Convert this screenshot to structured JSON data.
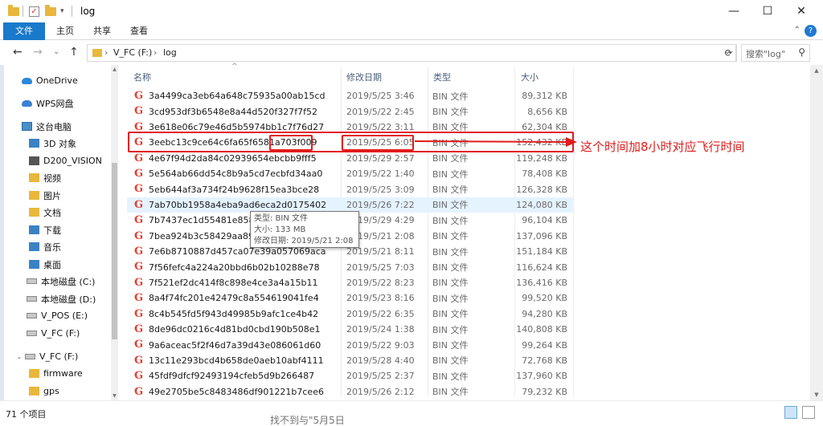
{
  "window": {
    "title": "log",
    "minimize": "—",
    "maximize": "☐",
    "close": "✕"
  },
  "ribbon": {
    "tabs": [
      "文件",
      "主页",
      "共享",
      "查看"
    ],
    "help": "?",
    "collapse": "⌃"
  },
  "address": {
    "back": "←",
    "forward": "→",
    "recent": "⌄",
    "up": "↑",
    "path": [
      "V_FC (F:)",
      "log"
    ],
    "separator": "›",
    "dropdown": "⌄",
    "refresh": "⟳",
    "search_placeholder": "搜索\"log\"",
    "search_icon": "search-icon"
  },
  "nav": {
    "items": [
      {
        "label": "OneDrive",
        "icon": "cloud-icon",
        "indent": 0
      },
      {
        "label": "WPS网盘",
        "icon": "cloud-icon",
        "indent": 0
      },
      {
        "label": "这台电脑",
        "icon": "computer-icon",
        "indent": 0
      },
      {
        "label": "3D 对象",
        "icon": "folder-icon",
        "indent": 1
      },
      {
        "label": "D200_VISION",
        "icon": "device-icon",
        "indent": 1
      },
      {
        "label": "视频",
        "icon": "folder-icon",
        "indent": 1
      },
      {
        "label": "图片",
        "icon": "folder-icon",
        "indent": 1
      },
      {
        "label": "文档",
        "icon": "folder-icon",
        "indent": 1
      },
      {
        "label": "下载",
        "icon": "folder-icon",
        "indent": 1
      },
      {
        "label": "音乐",
        "icon": "folder-icon",
        "indent": 1
      },
      {
        "label": "桌面",
        "icon": "folder-icon",
        "indent": 1
      },
      {
        "label": "本地磁盘 (C:)",
        "icon": "drive-icon",
        "indent": 1
      },
      {
        "label": "本地磁盘 (D:)",
        "icon": "drive-icon",
        "indent": 1
      },
      {
        "label": "V_POS (E:)",
        "icon": "drive-icon",
        "indent": 1
      },
      {
        "label": "V_FC (F:)",
        "icon": "drive-icon",
        "indent": 1
      },
      {
        "label": "V_FC (F:)",
        "icon": "drive-icon",
        "indent": 0
      },
      {
        "label": "firmware",
        "icon": "folder-icon",
        "indent": 1
      },
      {
        "label": "gps",
        "icon": "folder-icon",
        "indent": 1
      }
    ]
  },
  "columns": {
    "name": "名称",
    "date": "修改日期",
    "type": "类型",
    "size": "大小",
    "sort_caret": "^"
  },
  "files": [
    {
      "name": "3a4499ca3eb64a648c75935a00ab15cd",
      "date": "2019/5/25 3:46",
      "type": "BIN 文件",
      "size": "89,312 KB"
    },
    {
      "name": "3cd953df3b6548e8a44d520f327f7f52",
      "date": "2019/5/22 2:45",
      "type": "BIN 文件",
      "size": "8,656 KB"
    },
    {
      "name": "3e618e06c79e46d5b5974bb1c7f76d27",
      "date": "2019/5/22 3:11",
      "type": "BIN 文件",
      "size": "62,304 KB"
    },
    {
      "name": "3eebc13c9ce64c6fa65f6581a703f009",
      "date": "2019/5/25 6:05",
      "type": "BIN 文件",
      "size": "152,432 KB"
    },
    {
      "name": "4e67f94d2da84c02939654ebcbb9fff5",
      "date": "2019/5/29 2:57",
      "type": "BIN 文件",
      "size": "119,248 KB"
    },
    {
      "name": "5e564ab66dd54c8b9a5cd7ecbfd34aa0",
      "date": "2019/5/22 1:40",
      "type": "BIN 文件",
      "size": "78,408 KB"
    },
    {
      "name": "5eb644af3a734f24b9628f15ea3bce28",
      "date": "2019/5/25 3:09",
      "type": "BIN 文件",
      "size": "126,328 KB"
    },
    {
      "name": "7ab70bb1958a4eba9ad6eca2d0175402",
      "date": "2019/5/26 7:22",
      "type": "BIN 文件",
      "size": "124,080 KB"
    },
    {
      "name": "7b7437ec1d55481e858",
      "date": "2019/5/29 4:29",
      "type": "BIN 文件",
      "size": "96,104 KB"
    },
    {
      "name": "7bea924b3c58429aa89",
      "date": "2019/5/21 2:08",
      "type": "BIN 文件",
      "size": "137,096 KB"
    },
    {
      "name": "7e6b8710887d457ca07e39a057069aca",
      "date": "2019/5/21 8:11",
      "type": "BIN 文件",
      "size": "151,184 KB"
    },
    {
      "name": "7f56fefc4a224a20bbd6b02b10288e78",
      "date": "2019/5/25 7:03",
      "type": "BIN 文件",
      "size": "116,624 KB"
    },
    {
      "name": "7f521ef2dc414f8c898e4ce3a4a15b11",
      "date": "2019/5/22 8:23",
      "type": "BIN 文件",
      "size": "136,416 KB"
    },
    {
      "name": "8a4f74fc201e42479c8a554619041fe4",
      "date": "2019/5/23 8:16",
      "type": "BIN 文件",
      "size": "99,520 KB"
    },
    {
      "name": "8c4b545fd5f943d49985b9afc1ce4b42",
      "date": "2019/5/22 6:35",
      "type": "BIN 文件",
      "size": "94,280 KB"
    },
    {
      "name": "8de96dc0216c4d81bd0cbd190b508e1",
      "date": "2019/5/24 1:38",
      "type": "BIN 文件",
      "size": "140,808 KB"
    },
    {
      "name": "9a6aceac5f2f46d7a39d43e086061d60",
      "date": "2019/5/22 9:03",
      "type": "BIN 文件",
      "size": "99,264 KB"
    },
    {
      "name": "13c11e293bcd4b658de0aeb10abf4111",
      "date": "2019/5/28 4:40",
      "type": "BIN 文件",
      "size": "72,768 KB"
    },
    {
      "name": "45fdf9dfcf92493194cfeb5d9b266487",
      "date": "2019/5/25 2:37",
      "type": "BIN 文件",
      "size": "137,960 KB"
    },
    {
      "name": "49e2705be5c8483486df901221b7cee6",
      "date": "2019/5/26 2:12",
      "type": "BIN 文件",
      "size": "79,232 KB"
    }
  ],
  "tooltip": {
    "type_line": "类型: BIN 文件",
    "size_line": "大小: 133 MB",
    "date_line": "修改日期: 2019/5/21 2:08"
  },
  "annotation": {
    "text": "这个时间加8小时对应飞行时间",
    "color": "#e21b1b"
  },
  "status": {
    "count": "71 个项目"
  },
  "background_fragment": "找不到与\"5月5日"
}
